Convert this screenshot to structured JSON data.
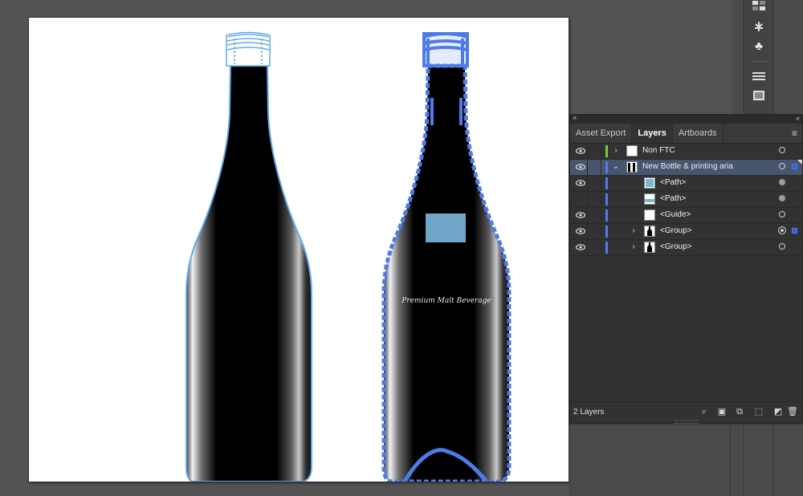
{
  "panel": {
    "close_icon": "×",
    "collapse_icon": "‹‹",
    "menu_icon": "≡",
    "tabs": [
      {
        "label": "Asset Export",
        "active": false
      },
      {
        "label": "Layers",
        "active": true
      },
      {
        "label": "Artboards",
        "active": false
      }
    ]
  },
  "layers": [
    {
      "name": "Non FTC",
      "visible": true,
      "expanded": false,
      "color": "#6fcf3c",
      "selected": false,
      "thumb": "blank"
    },
    {
      "name": "New Bottle & printing aria",
      "visible": true,
      "expanded": true,
      "color": "#4f7be8",
      "selected": true,
      "thumb": "bottles"
    },
    {
      "name": "<Path>",
      "visible": true,
      "expanded": null,
      "color": "#4f7be8",
      "selected": false,
      "thumb": "blue-rect"
    },
    {
      "name": "<Path>",
      "visible": false,
      "expanded": null,
      "color": "#4f7be8",
      "selected": false,
      "thumb": "blue-strip"
    },
    {
      "name": "<Guide>",
      "visible": true,
      "expanded": null,
      "color": "#4f7be8",
      "selected": false,
      "thumb": "blank"
    },
    {
      "name": "<Group>",
      "visible": true,
      "expanded": false,
      "color": "#4f7be8",
      "selected": false,
      "thumb": "bottle"
    },
    {
      "name": "<Group>",
      "visible": true,
      "expanded": false,
      "color": "#4f7be8",
      "selected": false,
      "thumb": "bottle"
    }
  ],
  "footer": {
    "layer_count": "2 Layers",
    "buttons": [
      "search-icon",
      "collect-for-export-icon",
      "make-clipping-mask-icon",
      "new-sublayer-icon",
      "new-layer-icon",
      "delete-icon"
    ]
  },
  "artboard": {
    "label_text": "Premium Malt Beverage",
    "bottle_fill": "#000000",
    "selection_color": "#4f7be8",
    "label_rect_color": "#6fa6c8"
  },
  "colors": {
    "workspace": "#535353",
    "panel": "#323232",
    "selected_row": "#47556e"
  }
}
